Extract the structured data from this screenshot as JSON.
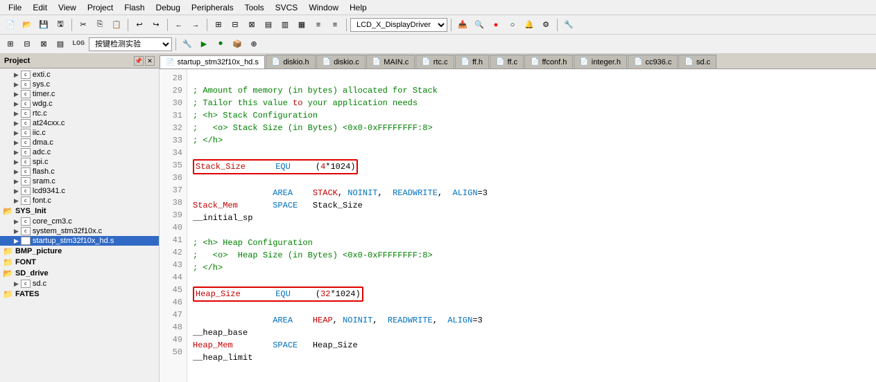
{
  "menubar": {
    "items": [
      "File",
      "Edit",
      "View",
      "Project",
      "Flash",
      "Debug",
      "Peripherals",
      "Tools",
      "SVCS",
      "Window",
      "Help"
    ]
  },
  "toolbar": {
    "dropdown_value": "LCD_X_DisplayDriver"
  },
  "toolbar2": {
    "label": "按键检测实验"
  },
  "sidebar": {
    "title": "Project",
    "tree_items": [
      {
        "indent": 1,
        "type": "file",
        "label": "exti.c"
      },
      {
        "indent": 1,
        "type": "file",
        "label": "sys.c"
      },
      {
        "indent": 1,
        "type": "file",
        "label": "timer.c"
      },
      {
        "indent": 1,
        "type": "file",
        "label": "wdg.c"
      },
      {
        "indent": 1,
        "type": "file",
        "label": "rtc.c"
      },
      {
        "indent": 1,
        "type": "file",
        "label": "at24cxx.c"
      },
      {
        "indent": 1,
        "type": "file",
        "label": "iic.c"
      },
      {
        "indent": 1,
        "type": "file",
        "label": "dma.c"
      },
      {
        "indent": 1,
        "type": "file",
        "label": "adc.c"
      },
      {
        "indent": 1,
        "type": "file",
        "label": "spi.c"
      },
      {
        "indent": 1,
        "type": "file",
        "label": "flash.c"
      },
      {
        "indent": 1,
        "type": "file",
        "label": "sram.c"
      },
      {
        "indent": 1,
        "type": "file",
        "label": "lcd9341.c"
      },
      {
        "indent": 1,
        "type": "file",
        "label": "font.c"
      },
      {
        "indent": 0,
        "type": "folder_open",
        "label": "SYS_Init"
      },
      {
        "indent": 1,
        "type": "file",
        "label": "core_cm3.c"
      },
      {
        "indent": 1,
        "type": "file",
        "label": "system_stm32f10x.c"
      },
      {
        "indent": 1,
        "type": "file",
        "label": "startup_stm32f10x_hd.s"
      },
      {
        "indent": 0,
        "type": "folder_closed",
        "label": "BMP_picture"
      },
      {
        "indent": 0,
        "type": "folder_closed",
        "label": "FONT"
      },
      {
        "indent": 0,
        "type": "folder_open",
        "label": "SD_drive"
      },
      {
        "indent": 1,
        "type": "file",
        "label": "sd.c"
      },
      {
        "indent": 0,
        "type": "folder_closed",
        "label": "FATES"
      }
    ]
  },
  "tabs": [
    {
      "label": "startup_stm32f10x_hd.s",
      "active": true
    },
    {
      "label": "diskio.h",
      "active": false
    },
    {
      "label": "diskio.c",
      "active": false
    },
    {
      "label": "MAIN.c",
      "active": false
    },
    {
      "label": "rtc.c",
      "active": false
    },
    {
      "label": "ff.h",
      "active": false
    },
    {
      "label": "ff.c",
      "active": false
    },
    {
      "label": "ffconf.h",
      "active": false
    },
    {
      "label": "integer.h",
      "active": false
    },
    {
      "label": "cc936.c",
      "active": false
    },
    {
      "label": "sd.c",
      "active": false
    }
  ],
  "code": {
    "lines": [
      {
        "num": "28",
        "text": "",
        "type": "empty"
      },
      {
        "num": "29",
        "text": "; Amount of memory (in bytes) allocated for Stack",
        "type": "comment"
      },
      {
        "num": "30",
        "text": "; Tailor this value to your application needs",
        "type": "comment"
      },
      {
        "num": "31",
        "text": "; <h> Stack Configuration",
        "type": "comment"
      },
      {
        "num": "32",
        "text": ";   <o> Stack Size (in Bytes) <0x0-0xFFFFFFFF:8>",
        "type": "comment"
      },
      {
        "num": "33",
        "text": "; </h>",
        "type": "comment"
      },
      {
        "num": "34",
        "text": "",
        "type": "empty"
      },
      {
        "num": "35",
        "text": "Stack_Size      EQU     (4*1024)",
        "type": "highlight_stack"
      },
      {
        "num": "36",
        "text": "",
        "type": "empty"
      },
      {
        "num": "37",
        "text": "                AREA    STACK, NOINIT,  READWRITE,  ALIGN=3",
        "type": "asm"
      },
      {
        "num": "38",
        "text": "Stack_Mem       SPACE   Stack_Size",
        "type": "asm2"
      },
      {
        "num": "39",
        "text": "__initial_sp",
        "type": "label"
      },
      {
        "num": "40",
        "text": "",
        "type": "empty"
      },
      {
        "num": "41",
        "text": "; <h> Heap Configuration",
        "type": "comment"
      },
      {
        "num": "42",
        "text": ";   <o>  Heap Size (in Bytes) <0x0-0xFFFFFFFF:8>",
        "type": "comment"
      },
      {
        "num": "43",
        "text": "; </h>",
        "type": "comment"
      },
      {
        "num": "44",
        "text": "",
        "type": "empty"
      },
      {
        "num": "45",
        "text": "Heap_Size       EQU     (32*1024)",
        "type": "highlight_heap"
      },
      {
        "num": "46",
        "text": "",
        "type": "empty"
      },
      {
        "num": "47",
        "text": "                AREA    HEAP, NOINIT,  READWRITE,  ALIGN=3",
        "type": "asm"
      },
      {
        "num": "48",
        "text": "__heap_base",
        "type": "label"
      },
      {
        "num": "49",
        "text": "Heap_Mem        SPACE   Heap_Size",
        "type": "asm2"
      },
      {
        "num": "50",
        "text": "__heap_limit",
        "type": "label"
      }
    ]
  }
}
